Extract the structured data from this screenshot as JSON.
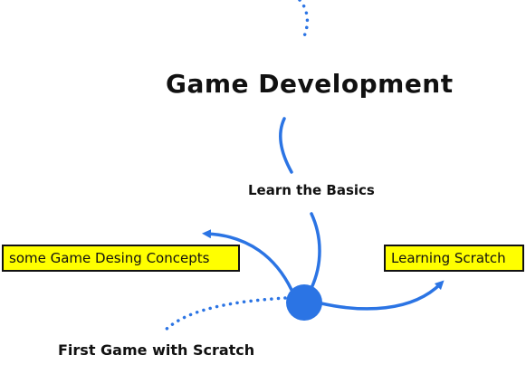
{
  "diagram": {
    "title": "Game Development",
    "basics_label": "Learn the Basics",
    "first_game_label": "First Game with Scratch",
    "concepts_box": "some Game Desing Concepts",
    "scratch_box": "Learning Scratch",
    "colors": {
      "line": "#2b74e4",
      "box_fill": "#ffff00",
      "box_border": "#111111",
      "text": "#111111"
    }
  }
}
